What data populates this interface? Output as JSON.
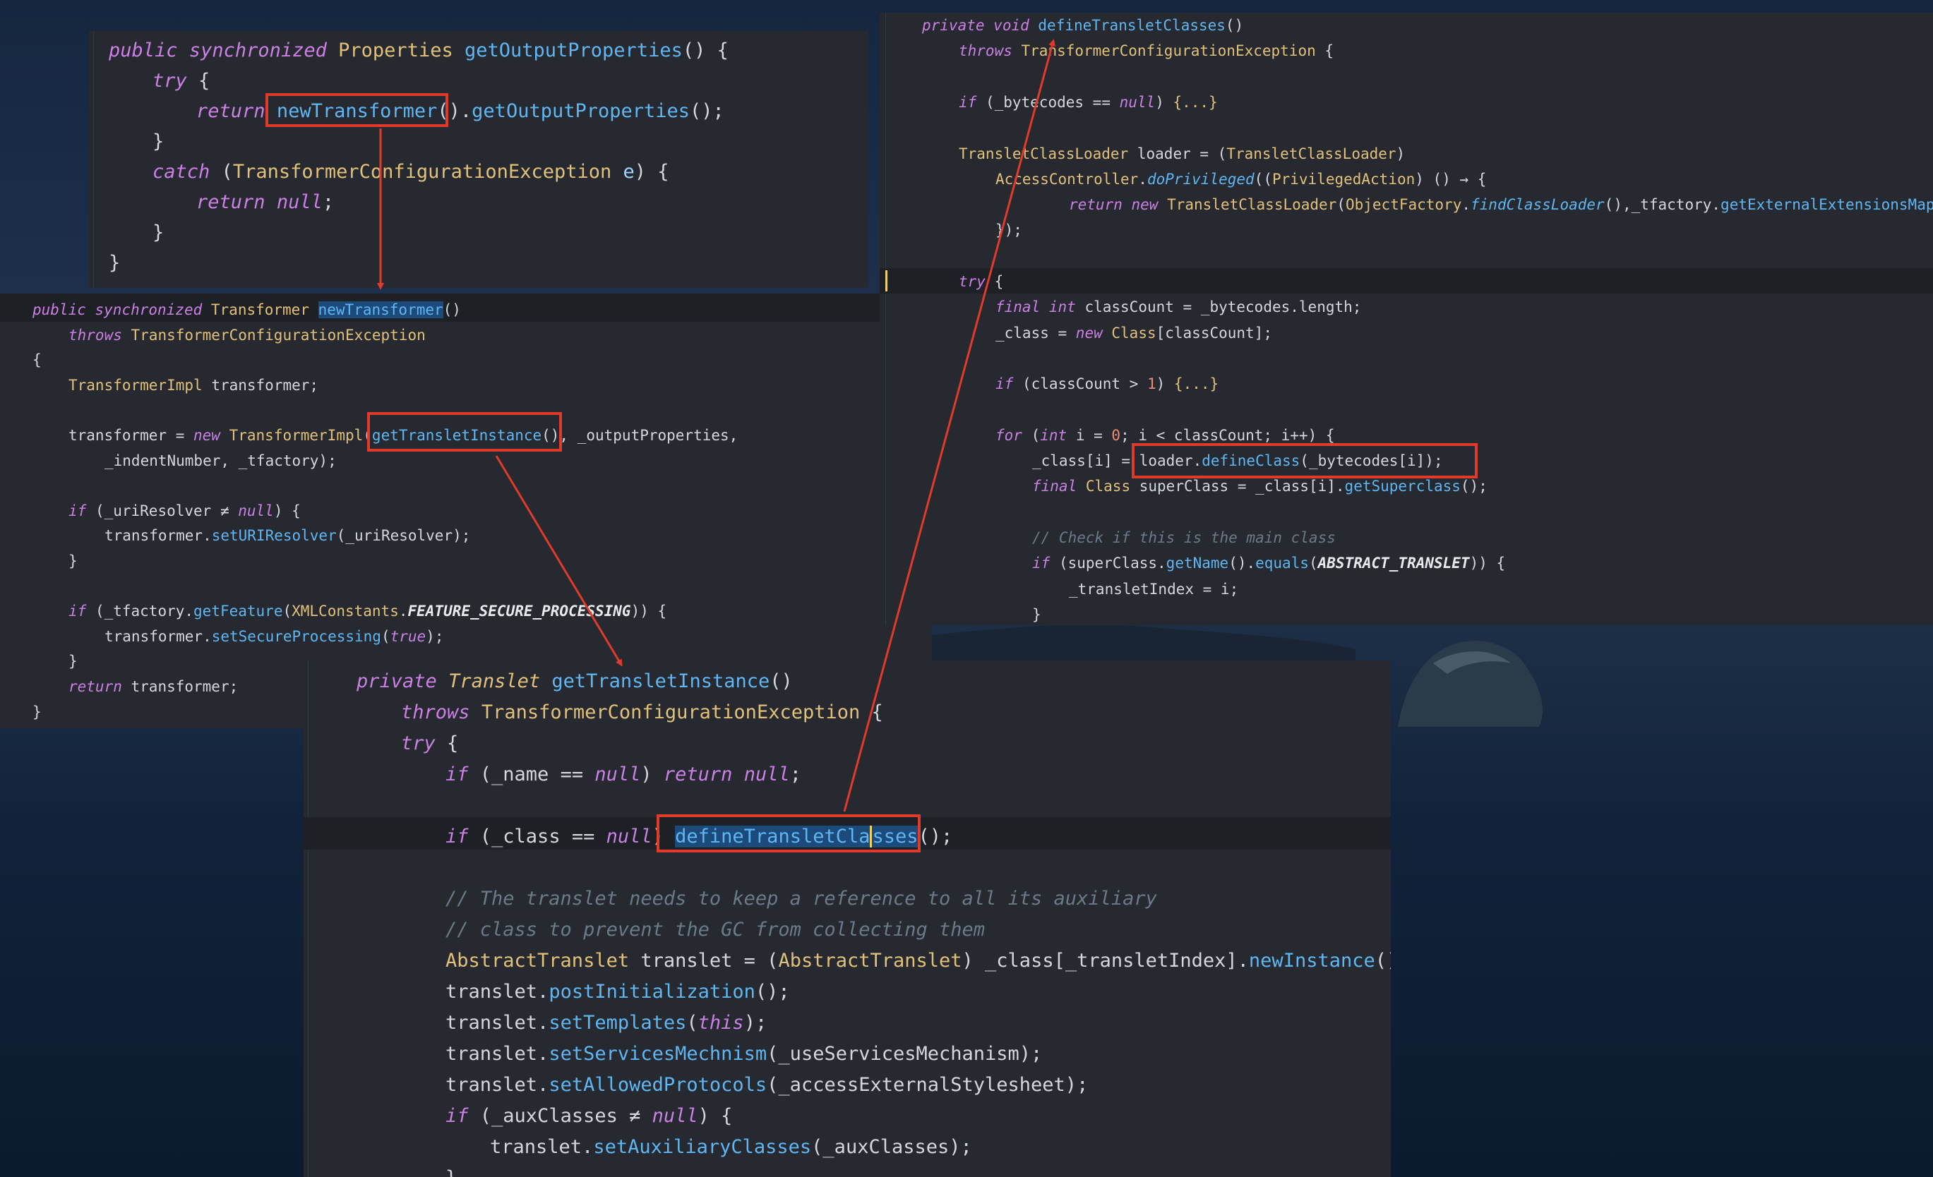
{
  "panels": {
    "a": [
      "public synchronized Properties getOutputProperties() {",
      "try {",
      "return newTransformer().getOutputProperties();",
      "}",
      "catch (TransformerConfigurationException e) {",
      "return null;",
      "}",
      "}"
    ],
    "b": [
      "public synchronized Transformer newTransformer()",
      "throws TransformerConfigurationException",
      "{",
      "TransformerImpl transformer;",
      "",
      "transformer = new TransformerImpl(getTransletInstance(), _outputProperties,",
      "_indentNumber, _tfactory);",
      "",
      "if (_uriResolver ≠ null) {",
      "transformer.setURIResolver(_uriResolver);",
      "}",
      "",
      "if (_tfactory.getFeature(XMLConstants.FEATURE_SECURE_PROCESSING)) {",
      "transformer.setSecureProcessing(true);",
      "}",
      "return transformer;",
      "}"
    ],
    "c": [
      "private void defineTransletClasses()",
      "throws TransformerConfigurationException {",
      "",
      "if (_bytecodes == null) {...}",
      "",
      "TransletClassLoader loader = (TransletClassLoader)",
      "AccessController.doPrivileged((PrivilegedAction) () → {",
      "return new TransletClassLoader(ObjectFactory.findClassLoader(),_tfactory.getExternalExtensionsMap());",
      "});",
      "",
      "try {",
      "final int classCount = _bytecodes.length;",
      "_class = new Class[classCount];",
      "",
      "if (classCount > 1) {...}",
      "",
      "for (int i = 0; i < classCount; i++) {",
      "_class[i] = loader.defineClass(_bytecodes[i]);",
      "final Class superClass = _class[i].getSuperclass();",
      "",
      "// Check if this is the main class",
      "if (superClass.getName().equals(ABSTRACT_TRANSLET)) {",
      "_transletIndex = i;",
      "}"
    ],
    "d": [
      "private Translet getTransletInstance()",
      "throws TransformerConfigurationException {",
      "try {",
      "if (_name == null) return null;",
      "",
      "if (_class == null) defineTransletClasses();",
      "",
      "// The translet needs to keep a reference to all its auxiliary",
      "// class to prevent the GC from collecting them",
      "AbstractTranslet translet = (AbstractTranslet) _class[_transletIndex].newInstance();",
      "translet.postInitialization();",
      "translet.setTemplates(this);",
      "translet.setServicesMechnism(_useServicesMechanism);",
      "translet.setAllowedProtocols(_accessExternalStylesheet);",
      "if (_auxClasses ≠ null) {",
      "translet.setAuxiliaryClasses(_auxClasses);",
      "}"
    ]
  },
  "colors": {
    "panel_bg": "#262a30",
    "highlight_box": "#e03a2a",
    "keyword": "#cc7fe5",
    "type": "#e3c07a",
    "function": "#5fb6f2"
  }
}
